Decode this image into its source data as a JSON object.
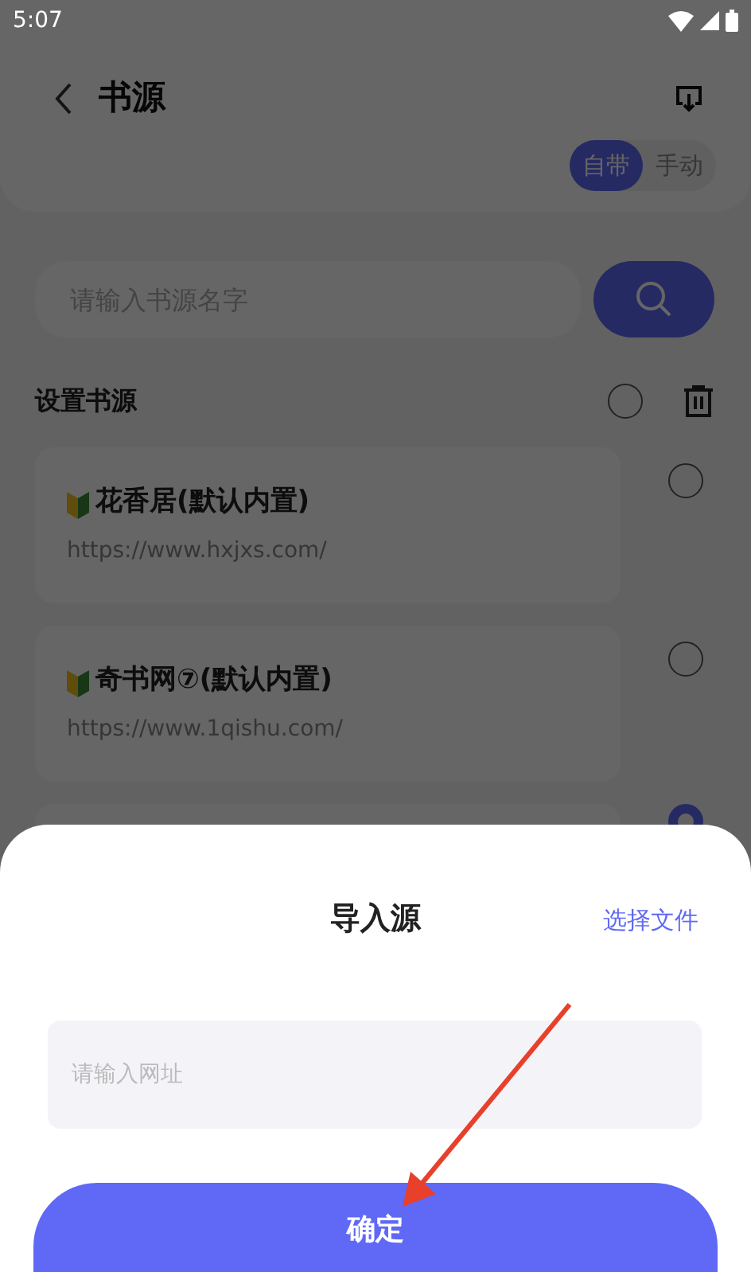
{
  "status_bar": {
    "time": "5:07"
  },
  "header": {
    "title": "书源"
  },
  "source_toggle": [
    {
      "label": "自带",
      "selected": true
    },
    {
      "label": "手动",
      "selected": false
    }
  ],
  "search": {
    "placeholder": "请输入书源名字"
  },
  "section": {
    "title": "设置书源",
    "select_all": false
  },
  "sources": [
    {
      "name": "花香居(默认内置)",
      "url": "https://www.hxjxs.com/",
      "selected": false
    },
    {
      "name": "奇书网⑦(默认内置)",
      "url": "https://www.1qishu.com/",
      "selected": false
    },
    {
      "selected": true
    }
  ],
  "import_sheet": {
    "title": "导入源",
    "file_link": "选择文件",
    "url_field": {
      "placeholder": "请输入网址"
    },
    "confirm": "确定"
  }
}
